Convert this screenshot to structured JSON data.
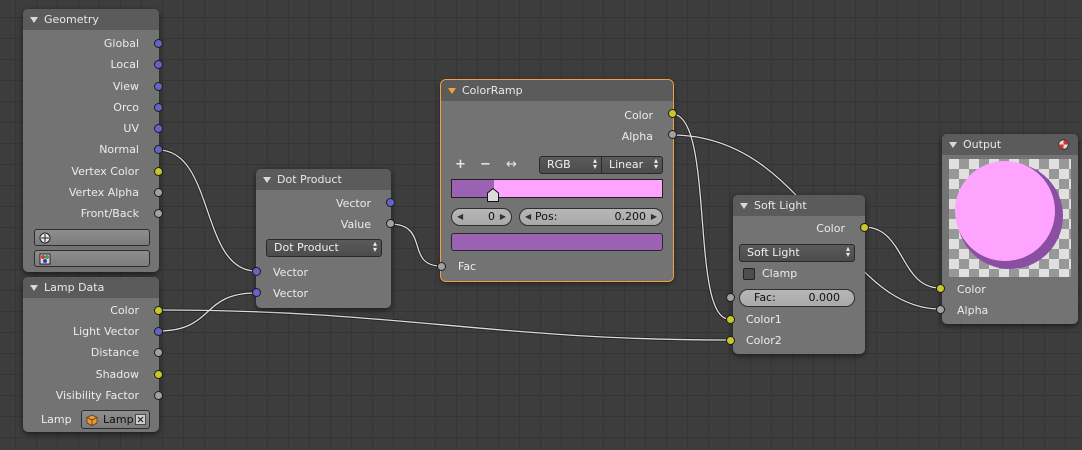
{
  "geometry": {
    "title": "Geometry",
    "outputs": [
      "Global",
      "Local",
      "View",
      "Orco",
      "UV",
      "Normal",
      "Vertex Color",
      "Vertex Alpha",
      "Front/Back"
    ]
  },
  "lamp_data": {
    "title": "Lamp Data",
    "outputs": [
      "Color",
      "Light Vector",
      "Distance",
      "Shadow",
      "Visibility Factor"
    ],
    "lamp_label": "Lamp",
    "lamp_value": "Lamp"
  },
  "dot_product": {
    "title": "Dot Product",
    "outputs": [
      "Vector",
      "Value"
    ],
    "operation": "Dot Product",
    "inputs": [
      "Vector",
      "Vector"
    ]
  },
  "color_ramp": {
    "title": "ColorRamp",
    "outputs": [
      "Color",
      "Alpha"
    ],
    "add_label": "+",
    "remove_label": "−",
    "flip_label": "↔",
    "color_mode": "RGB",
    "interpolation": "Linear",
    "active_stop": "0",
    "pos_label": "Pos:",
    "pos_value": "0.200",
    "input": "Fac",
    "stop_position": 0.2,
    "color_left": "#9b62b4",
    "color_right": "#fea3fe"
  },
  "soft_light": {
    "title": "Soft Light",
    "output": "Color",
    "blend_mode": "Soft Light",
    "clamp_label": "Clamp",
    "fac_label": "Fac:",
    "fac_value": "0.000",
    "inputs": [
      "Color1",
      "Color2"
    ]
  },
  "output": {
    "title": "Output",
    "inputs": [
      "Color",
      "Alpha"
    ],
    "preview_color": "#fea3fe"
  }
}
